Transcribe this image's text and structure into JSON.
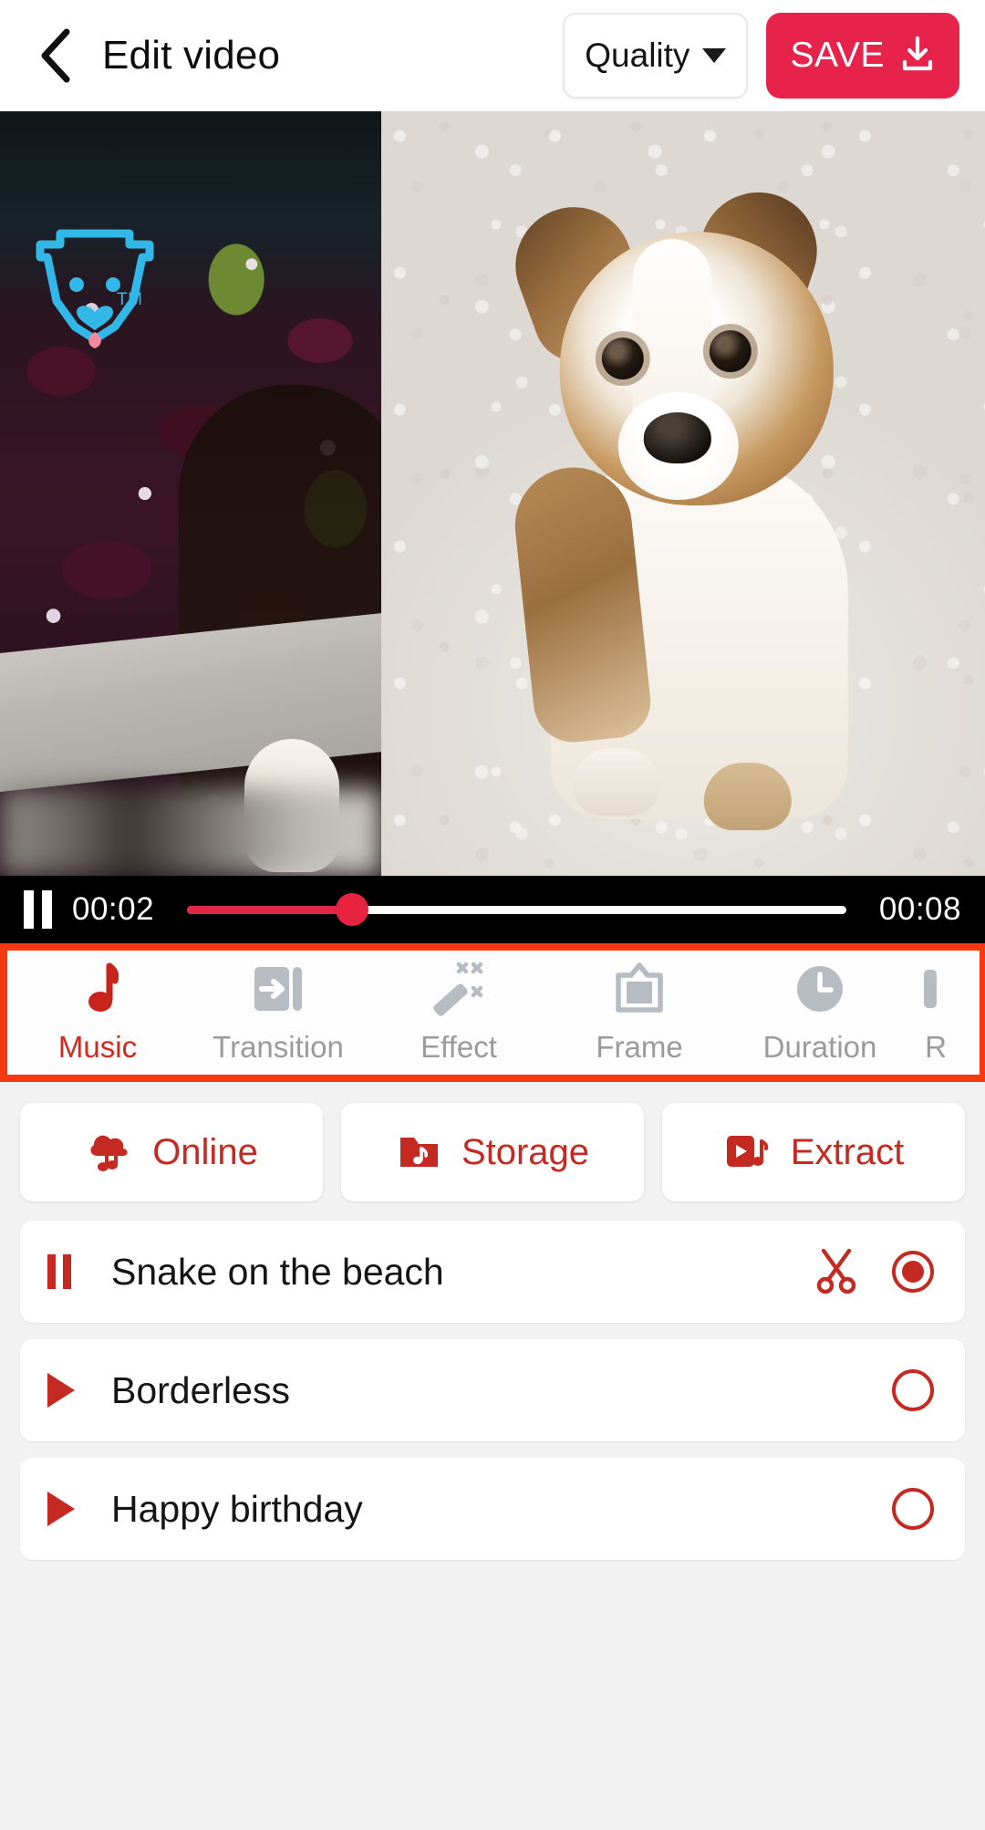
{
  "header": {
    "back_icon": "chevron-left-icon",
    "title": "Edit video",
    "quality_label": "Quality",
    "quality_caret": "chevron-down-icon",
    "save_label": "SAVE",
    "save_icon": "download-icon",
    "save_color": "#e8234b"
  },
  "preview": {
    "watermark_icon": "dog-face-logo",
    "watermark_tm": "TM",
    "watermark_color": "#31b7e8"
  },
  "player": {
    "pause_icon": "pause-icon",
    "current_time": "00:02",
    "total_time": "00:08",
    "progress_percent": 25,
    "track_color": "#e22745"
  },
  "toolbar": {
    "highlight_color": "#f63a10",
    "active_color": "#d12a20",
    "inactive_color": "#9b9b9b",
    "items": [
      {
        "label": "Music",
        "icon": "music-note-icon",
        "active": true
      },
      {
        "label": "Transition",
        "icon": "transition-arrow-icon",
        "active": false
      },
      {
        "label": "Effect",
        "icon": "magic-wand-icon",
        "active": false
      },
      {
        "label": "Frame",
        "icon": "frame-picture-icon",
        "active": false
      },
      {
        "label": "Duration",
        "icon": "clock-icon",
        "active": false
      },
      {
        "label": "R",
        "icon": "ratio-icon",
        "active": false
      }
    ]
  },
  "sources": {
    "accent_color": "#c42a22",
    "buttons": [
      {
        "label": "Online",
        "icon": "cloud-music-icon"
      },
      {
        "label": "Storage",
        "icon": "folder-music-icon"
      },
      {
        "label": "Extract",
        "icon": "video-music-extract-icon"
      }
    ]
  },
  "music_list": {
    "tracks": [
      {
        "title": "Snake on the beach",
        "state": "playing",
        "state_icon": "pause-icon",
        "has_trim": true,
        "trim_icon": "scissors-icon",
        "selected": true,
        "radio_icon": "radio-selected-icon"
      },
      {
        "title": "Borderless",
        "state": "stopped",
        "state_icon": "play-icon",
        "has_trim": false,
        "selected": false,
        "radio_icon": "radio-unselected-icon"
      },
      {
        "title": "Happy birthday",
        "state": "stopped",
        "state_icon": "play-icon",
        "has_trim": false,
        "selected": false,
        "radio_icon": "radio-unselected-icon"
      }
    ]
  }
}
